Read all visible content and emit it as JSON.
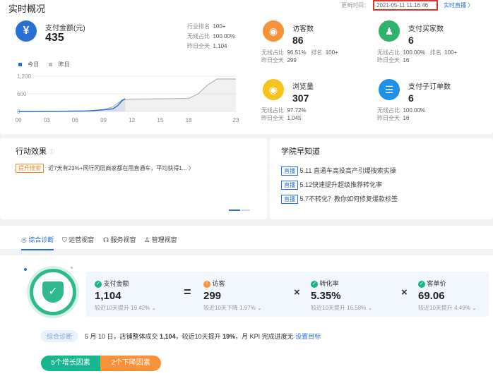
{
  "realtime": {
    "title": "实时概况",
    "update_label": "更新时间：",
    "update_time": "2021-05-11 11:16:46",
    "link": "实时直播 〉",
    "pay": {
      "name": "支付金额(元)",
      "value": "435",
      "rank_label": "行业排名",
      "rank": "100+",
      "wireless_label": "无线占比",
      "wireless": "100.00%",
      "yesterday_label": "昨日全天",
      "yesterday": "1,104"
    },
    "legend": {
      "today": "今日",
      "yesterday": "昨日"
    },
    "metrics": [
      {
        "name": "访客数",
        "value": "86",
        "l1": "无线占比",
        "v1": "96.51%",
        "l2": "排名",
        "v2": "100+",
        "l3": "昨日全天",
        "v3": "299"
      },
      {
        "name": "支付买家数",
        "value": "6",
        "l1": "无线占比",
        "v1": "100.00%",
        "l2": "排名",
        "v2": "100+",
        "l3": "昨日全天",
        "v3": "16"
      },
      {
        "name": "浏览量",
        "value": "307",
        "l1": "无线占比",
        "v1": "97.72%",
        "l3": "昨日全天",
        "v3": "1,045"
      },
      {
        "name": "支付子订单数",
        "value": "6",
        "l1": "无线占比",
        "v1": "100.00%",
        "l3": "昨日全天",
        "v3": "16"
      }
    ],
    "colors": {
      "accent": "#2a6fd6",
      "orange": "#f6933a",
      "green": "#2db36b",
      "yellow": "#f6c21c",
      "blue": "#1e90e6"
    }
  },
  "chart_data": {
    "type": "line",
    "x": [
      "00",
      "03",
      "06",
      "09",
      "12",
      "15",
      "18",
      "23"
    ],
    "ytick_labels": [
      "1,200",
      "600",
      "0"
    ],
    "ylim": [
      0,
      1200
    ],
    "series": [
      {
        "name": "今日",
        "points": [
          [
            0,
            0
          ],
          [
            1,
            0
          ],
          [
            2,
            0
          ],
          [
            3,
            5
          ],
          [
            4,
            8
          ],
          [
            5,
            10
          ],
          [
            6,
            12
          ],
          [
            7,
            15
          ],
          [
            8,
            30
          ],
          [
            9,
            60
          ],
          [
            10,
            90
          ],
          [
            10.5,
            200
          ],
          [
            11,
            380
          ],
          [
            11.3,
            435
          ]
        ]
      },
      {
        "name": "昨日",
        "points": [
          [
            0,
            0
          ],
          [
            3,
            0
          ],
          [
            6,
            5
          ],
          [
            8,
            20
          ],
          [
            9,
            50
          ],
          [
            10,
            160
          ],
          [
            11,
            400
          ],
          [
            12,
            420
          ],
          [
            15,
            430
          ],
          [
            18,
            445
          ],
          [
            19,
            600
          ],
          [
            20,
            900
          ],
          [
            21,
            1104
          ],
          [
            23,
            1104
          ]
        ]
      }
    ]
  },
  "action": {
    "title": "行动效果",
    "tag": "提升搜索",
    "text": "近7天有23%+同行同层商家都在用直通车，平均获得1... 〉"
  },
  "academy": {
    "title": "学院早知道",
    "tag": "直播",
    "items": [
      "5.11 直通车高投高产引爆搜索实操",
      "5.12快速提升超级推荐转化率",
      "5.7不转化？教你如何修复爆款标签"
    ]
  },
  "tabs": [
    "综合诊断",
    "运营视窗",
    "服务视窗",
    "管理视窗"
  ],
  "diag": {
    "formula": [
      {
        "name": "支付金额",
        "value": "1,104",
        "note": "较近10天提升 19.42%"
      },
      {
        "name": "访客",
        "value": "299",
        "note": "较近10天下降 1.97%"
      },
      {
        "name": "转化率",
        "value": "5.35%",
        "note": "较近10天提升 16.58%"
      },
      {
        "name": "客单价",
        "value": "69.06",
        "note": "较近10天提升 4.49%"
      }
    ],
    "ops": [
      "=",
      "×",
      "×"
    ],
    "badge": "综合诊断",
    "summary_prefix": "5 月 10 日，店铺整体成交 ",
    "summary_amount": "1,104",
    "summary_mid": "，较近10天提升 ",
    "summary_pct": "19%",
    "summary_suffix": "，月 KPI 完成进度无 ",
    "summary_link": "设置目标",
    "pill_growth": "5个增长因素",
    "pill_decline": "2个下降因素"
  }
}
